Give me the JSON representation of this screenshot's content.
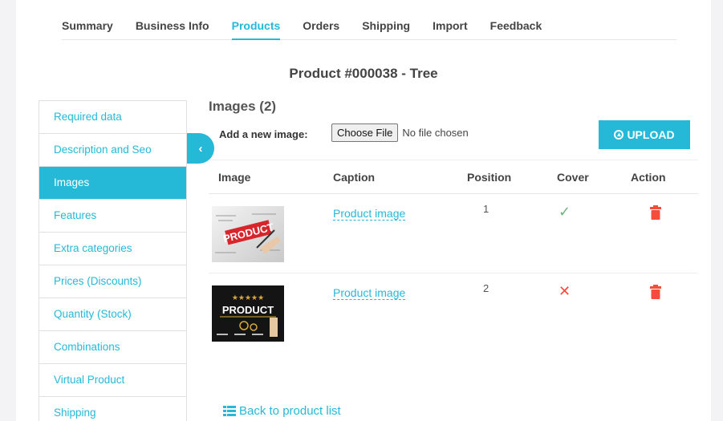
{
  "tabs": [
    {
      "label": "Summary"
    },
    {
      "label": "Business Info"
    },
    {
      "label": "Products",
      "active": true
    },
    {
      "label": "Orders"
    },
    {
      "label": "Shipping"
    },
    {
      "label": "Import"
    },
    {
      "label": "Feedback"
    }
  ],
  "product_title": "Product #000038 - Tree",
  "sidebar": {
    "items": [
      {
        "label": "Required data"
      },
      {
        "label": "Description and Seo"
      },
      {
        "label": "Images",
        "active": true
      },
      {
        "label": "Features"
      },
      {
        "label": "Extra categories"
      },
      {
        "label": "Prices (Discounts)"
      },
      {
        "label": "Quantity (Stock)"
      },
      {
        "label": "Combinations"
      },
      {
        "label": "Virtual Product"
      },
      {
        "label": "Shipping"
      }
    ],
    "collapse_icon": "chevron-left-icon"
  },
  "images_section": {
    "heading": "Images (2)",
    "add_label": "Add a new image:",
    "choose_file_label": "Choose File",
    "no_file_text": "No file chosen",
    "upload_label": "UPLOAD",
    "upload_icon": "upload-circle-icon"
  },
  "table": {
    "headers": {
      "image": "Image",
      "caption": "Caption",
      "position": "Position",
      "cover": "Cover",
      "action": "Action"
    },
    "rows": [
      {
        "thumbnail_text": "PRODUCT",
        "caption": "Product image",
        "position": "1",
        "cover": "yes",
        "cover_symbol": "✓",
        "action_icon": "trash-icon"
      },
      {
        "thumbnail_text": "PRODUCT",
        "caption": "Product image",
        "position": "2",
        "cover": "no",
        "cover_symbol": "✕",
        "action_icon": "trash-icon"
      }
    ]
  },
  "back_link": {
    "label": "Back to product list",
    "icon": "list-icon"
  },
  "colors": {
    "accent": "#25b9d7",
    "success": "#70b580",
    "danger": "#f54c3e"
  }
}
